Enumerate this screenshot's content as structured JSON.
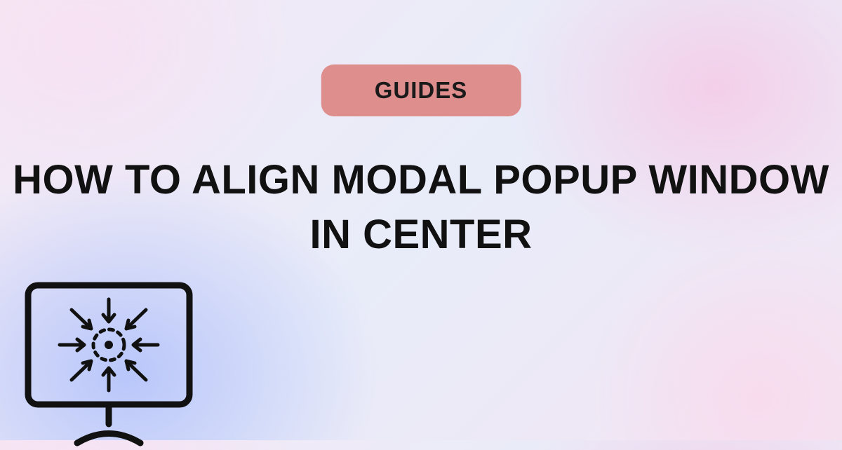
{
  "badge": {
    "label": "GUIDES"
  },
  "headline": {
    "text": "HOW TO ALIGN MODAL POPUP WINDOW IN CENTER"
  },
  "icon": {
    "name": "monitor-focus-center-icon"
  },
  "colors": {
    "badge_bg": "#df8e8e",
    "text": "#111111"
  }
}
